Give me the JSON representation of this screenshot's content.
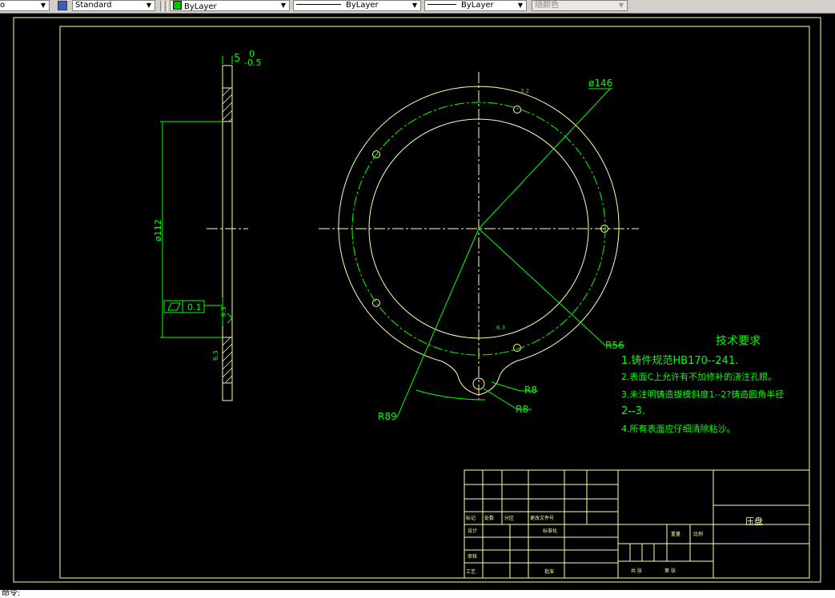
{
  "toolbar": {
    "textstyle_value": "Standard",
    "layer_color_value": "ByLayer",
    "linetype_value": "ByLayer",
    "lineweight_value": "ByLayer",
    "plotstyle_value": "随颜色",
    "first_combo_value": "o"
  },
  "colors": {
    "drawing_line": "#ffffaa",
    "dimension": "#00ff00",
    "frame": "#ffffaa",
    "background": "#000000"
  },
  "drawing": {
    "side_view": {
      "thickness_dim": "5",
      "tol_upper": "0",
      "tol_lower": "-0.5",
      "diameter_dim": "ø112",
      "flatness_tol": "0.1",
      "roughness_1": "6.3",
      "roughness_2": "6.3"
    },
    "front_view": {
      "diameter_dim": "ø146",
      "roughness_top": "3.2",
      "roughness_mid": "6.3",
      "radius_r56": "R56",
      "radius_r8_a": "R8",
      "radius_r8_b": "R8",
      "radius_r89": "R89"
    },
    "tech_requirements": {
      "title": "技术要求",
      "line1": "1.铸件规范HB170--241.",
      "line2": "2.表面C上允许有不加修补的浇注孔眼。",
      "line3": "3.未注明铸造拔模斜度1--2?铸造圆角半径",
      "line4": "2--3.",
      "line5": "4.所有表面应仔细清除粘沙。"
    },
    "title_block": {
      "part_name": "压盘",
      "r_marking": "标记",
      "r_count": "处数",
      "r_zone": "分区",
      "r_change_doc": "更改文件号",
      "r_design": "设计",
      "r_standardize": "标准化",
      "r_review": "审核",
      "r_process": "工艺",
      "r_approve": "批准",
      "r_weight": "重量",
      "r_scale": "比例",
      "r_total": "共  张",
      "r_sheet": "第  张"
    }
  },
  "command_line": "命令:"
}
